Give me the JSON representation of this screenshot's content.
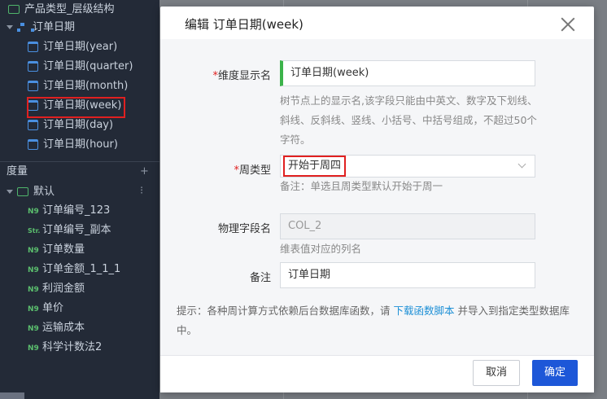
{
  "sidebar": {
    "dimension_items": [
      {
        "label": "产品类型_层级结构",
        "icon": "folder-icon"
      },
      {
        "label": "订单日期",
        "icon": "hierarchy-icon"
      },
      {
        "label": "订单日期(year)",
        "icon": "calendar-icon"
      },
      {
        "label": "订单日期(quarter)",
        "icon": "calendar-icon"
      },
      {
        "label": "订单日期(month)",
        "icon": "calendar-icon"
      },
      {
        "label": "订单日期(week)",
        "icon": "calendar-icon"
      },
      {
        "label": "订单日期(day)",
        "icon": "calendar-icon"
      },
      {
        "label": "订单日期(hour)",
        "icon": "calendar-icon"
      }
    ],
    "measure_header": "度量",
    "measure_tools": "+ ⁝",
    "measure_folder": "默认",
    "measure_items": [
      {
        "label": "订单编号_123",
        "type": "N9"
      },
      {
        "label": "订单编号_副本",
        "type": "Str."
      },
      {
        "label": "订单数量",
        "type": "N9"
      },
      {
        "label": "订单金额_1_1_1",
        "type": "N9"
      },
      {
        "label": "利润金额",
        "type": "N9"
      },
      {
        "label": "单价",
        "type": "N9"
      },
      {
        "label": "运输成本",
        "type": "N9"
      },
      {
        "label": "科学计数法2",
        "type": "N9"
      }
    ]
  },
  "dialog": {
    "title": "编辑 订单日期(week)",
    "display_name_label": "维度显示名",
    "display_name_value": "订单日期(week)",
    "display_name_hint": "树节点上的显示名,该字段只能由中英文、数字及下划线、斜线、反斜线、竖线、小括号、中括号组成，不超过50个字符。",
    "week_type_label": "周类型",
    "week_type_value": "开始于周四",
    "week_type_hint": "备注：单选且周类型默认开始于周一",
    "physical_field_label": "物理字段名",
    "physical_field_value": "COL_2",
    "physical_field_hint": "维表值对应的列名",
    "remark_label": "备注",
    "remark_value": "订单日期",
    "tip_prefix": "提示：各种周计算方式依赖后台数据库函数，请 ",
    "tip_link": "下载函数脚本",
    "tip_suffix": " 并导入到指定类型数据库中。",
    "required_mark": "*",
    "cancel_label": "取消",
    "ok_label": "确定"
  },
  "colors": {
    "accent_green": "#3cb34a",
    "primary_blue": "#1d57d8",
    "link_blue": "#1e90d6",
    "highlight_red": "#e02020"
  }
}
